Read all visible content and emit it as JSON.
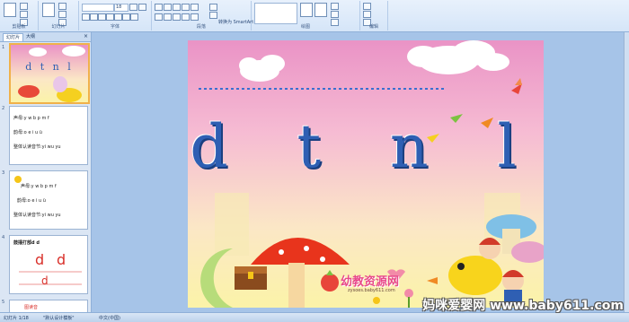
{
  "ribbon": {
    "groups": [
      {
        "label": "剪贴板"
      },
      {
        "label": "幻灯片"
      },
      {
        "label": "字体"
      },
      {
        "label": "段落"
      },
      {
        "label": "绘图"
      },
      {
        "label": "编辑"
      }
    ],
    "font_size": "18",
    "convert_smartart": "转换为 SmartArt"
  },
  "panel": {
    "tabs": [
      "幻灯片",
      "大纲"
    ]
  },
  "thumbs": {
    "t1": {
      "title": "d t n l"
    },
    "t2": {
      "line1": "声母:y w b p m f",
      "line2": "韵母:o e i u ü",
      "line3": "整体认读音节:yi wu yu"
    },
    "t3": {
      "line1": "声母:y w b p m f",
      "line2": "韵母:o e i u ü",
      "line3": "整体认读音节:yi wu yu"
    },
    "t4": {
      "line1": "鼓捶打部d d"
    },
    "t5": {
      "line1": "图读音"
    }
  },
  "slide": {
    "title": "d t n l",
    "logo_text": "幼教资源网",
    "logo_sub": "zysoes.baby611.com"
  },
  "status": {
    "left": "幻灯片 1/18",
    "theme": "\"默认设计模板\"",
    "lang": "中文(中国)"
  },
  "watermark": "妈咪爱婴网 www.baby611.com",
  "colors": {
    "title_blue": "#2e5fb3",
    "slide_pink": "#ea93c6",
    "slide_yellow": "#fbf3a8",
    "ribbon_bg": "#dbe8f8"
  }
}
